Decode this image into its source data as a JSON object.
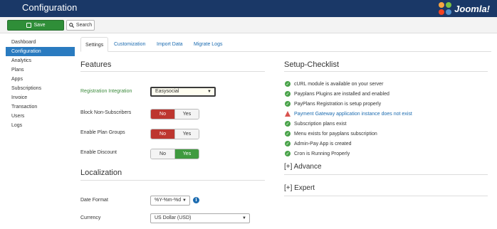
{
  "header": {
    "title": "Configuration",
    "logo_text": "Joomla!"
  },
  "toolbar": {
    "save_label": "Save",
    "search_label": "Search"
  },
  "sidebar": {
    "items": [
      {
        "label": "Dashboard"
      },
      {
        "label": "Configuration",
        "active": true
      },
      {
        "label": "Analytics"
      },
      {
        "label": "Plans"
      },
      {
        "label": "Apps"
      },
      {
        "label": "Subscriptions"
      },
      {
        "label": "Invoice"
      },
      {
        "label": "Transaction"
      },
      {
        "label": "Users"
      },
      {
        "label": "Logs"
      }
    ]
  },
  "tabs": [
    {
      "label": "Settings",
      "active": true
    },
    {
      "label": "Customization"
    },
    {
      "label": "Import Data"
    },
    {
      "label": "Migrate Logs"
    }
  ],
  "features": {
    "title": "Features",
    "registration_label": "Registration Integration",
    "registration_value": "Easysocial",
    "block_label": "Block Non-Subscribers",
    "groups_label": "Enable Plan Groups",
    "discount_label": "Enable Discount",
    "no": "No",
    "yes": "Yes"
  },
  "localization": {
    "title": "Localization",
    "date_label": "Date Format",
    "date_value": "%Y-%m-%d",
    "currency_label": "Currency",
    "currency_value": "US Dollar (USD)"
  },
  "checklist": {
    "title": "Setup-Checklist",
    "items": [
      {
        "text": "cURL module is available on your server",
        "status": "ok"
      },
      {
        "text": "Payplans Plugins are installed and enabled",
        "status": "ok"
      },
      {
        "text": "PayPlans Registration is setup properly",
        "status": "ok"
      },
      {
        "text": "Payment Gateway application instance does not exist",
        "status": "warn"
      },
      {
        "text": "Subscription plans exist",
        "status": "ok"
      },
      {
        "text": "Menu exists for payplans subscription",
        "status": "ok"
      },
      {
        "text": "Admin-Pay App is created",
        "status": "ok"
      },
      {
        "text": "Cron is Running Properly",
        "status": "ok"
      }
    ],
    "advance_label": "[+] Advance",
    "expert_label": "[+] Expert"
  },
  "colors": {
    "header": "#1a3867",
    "active": "#2a7bc0",
    "success": "#2f8e38",
    "danger": "#bd362f"
  }
}
